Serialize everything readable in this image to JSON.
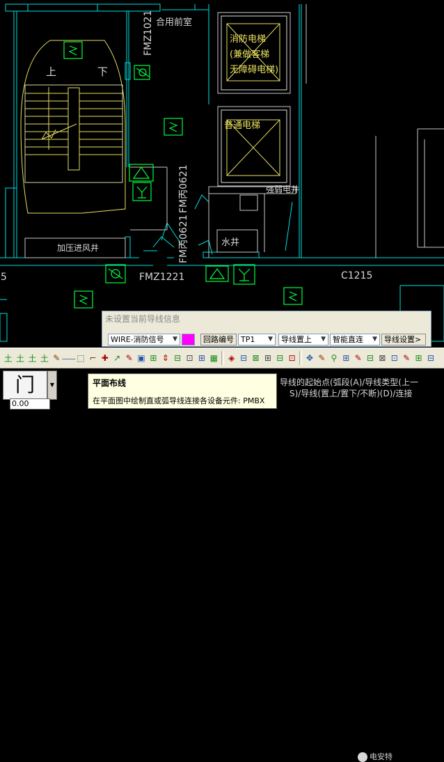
{
  "cad": {
    "labels": {
      "hall": "合用前室",
      "up": "上",
      "down": "下",
      "fire_elevator_l1": "消防电梯",
      "fire_elevator_l2": "(兼做客梯",
      "fire_elevator_l3": "无障碍电梯)",
      "normal_elevator": "普通电梯",
      "fresh_air_shaft": "加压进风井",
      "water_shaft": "水井",
      "strong_shaft": "强弱电井",
      "door_fmz1021": "FMZ1021",
      "door_fmc0621a": "FM丙0621",
      "door_fmc0621b": "FM丙0621",
      "door_fmc0621c": "FM丙0621",
      "door_fmz1221": "FMZ1221",
      "window_c1215": "C1215",
      "left_edge": "5"
    }
  },
  "wire_panel": {
    "title": "未设置当前导线信息",
    "wire_type": "WIRE-消防信号",
    "swatch_color": "#ff00ff",
    "loop_label": "回路编号",
    "loop_value": "TP1",
    "wire_position": "导线置上",
    "smart_straight": "智能直连",
    "wire_settings": "导线设置>"
  },
  "toolbar": {
    "icons": [
      "⼟",
      "⼟",
      "⼟",
      "⼟",
      "✎",
      "⸺",
      "⬚",
      "⌐",
      "✚",
      "↗",
      "✎",
      "▣",
      "⊞",
      "⇕",
      "⊟",
      "⊡",
      "⊞",
      "▦",
      "◈",
      "⊟",
      "⊠",
      "⊞",
      "⊟",
      "⊡",
      "✥",
      "✎",
      "⚲",
      "⊞",
      "✎",
      "⊟",
      "⊠",
      "⊡",
      "✎",
      "⊞",
      "⊟"
    ]
  },
  "bottom": {
    "thumb_glyph": "门",
    "coord": "0.00",
    "tooltip_title": "平面布线",
    "tooltip_desc": "在平面图中绘制直或弧导线连接各设备元件: PMBX",
    "cmd_line1": "导线的起始点(弧段(A)/导线类型(上一",
    "cmd_line2": "S)/导线(置上/置下/不断)(D)/连接",
    "watermark": "电安特"
  }
}
